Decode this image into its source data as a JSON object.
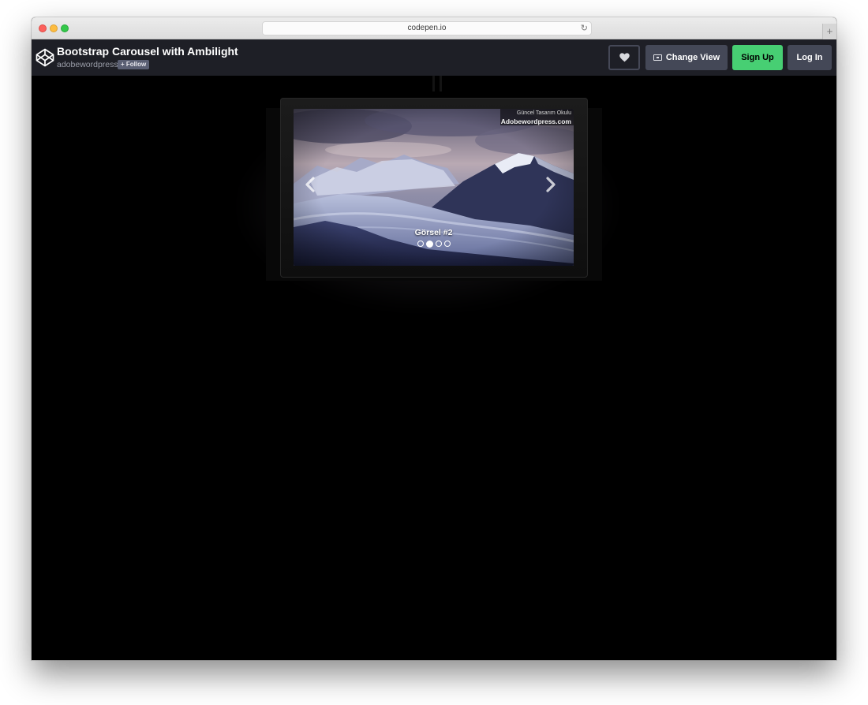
{
  "browser": {
    "url": "codepen.io",
    "reload_icon": "reload-icon",
    "newtab_label": "+"
  },
  "header": {
    "title": "Bootstrap Carousel with Ambilight",
    "author": "adobewordpress",
    "follow_label": "+ Follow",
    "heart_icon": "heart-icon",
    "change_view_label": "Change View",
    "signup_label": "Sign Up",
    "login_label": "Log In",
    "colors": {
      "header_bg": "#1e1f26",
      "signup_green": "#47cf73",
      "button_gray": "#444857"
    }
  },
  "carousel": {
    "watermark_top": "Güncel Tasarım Okulu",
    "watermark_bottom": "Adobewordpress.com",
    "caption": "Görsel #2",
    "slide_count": 4,
    "active_slide": 2,
    "prev_icon": "chevron-left-icon",
    "next_icon": "chevron-right-icon"
  }
}
